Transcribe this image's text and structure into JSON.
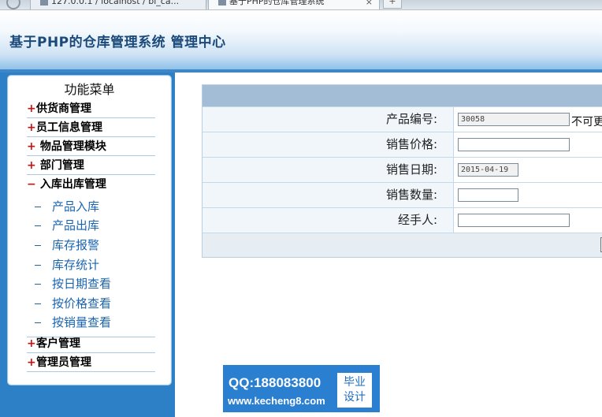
{
  "browser": {
    "tabs": [
      {
        "label": "127.0.0.1 / localhost / bi_ca..."
      },
      {
        "label": "基于PHP的仓库管理系统"
      }
    ],
    "new_tab": "+",
    "close": "×"
  },
  "header": {
    "title": "基于PHP的仓库管理系统 管理中心"
  },
  "sidebar": {
    "title": "功能菜单",
    "items": [
      {
        "sign": "+",
        "label": "供货商管理"
      },
      {
        "sign": "+",
        "label": "员工信息管理"
      },
      {
        "sign": "+",
        "label": " 物品管理模块"
      },
      {
        "sign": "+",
        "label": " 部门管理"
      },
      {
        "sign": "−",
        "label": " 入库出库管理"
      }
    ],
    "sub_items": [
      {
        "label": "产品入库"
      },
      {
        "label": "产品出库"
      },
      {
        "label": "库存报警"
      },
      {
        "label": "库存统计"
      },
      {
        "label": "按日期查看"
      },
      {
        "label": "按价格查看"
      },
      {
        "label": "按销量查看"
      }
    ],
    "bottom_items": [
      {
        "sign": "+",
        "label": "客户管理"
      },
      {
        "sign": "+",
        "label": "管理员管理"
      }
    ]
  },
  "form": {
    "rows": [
      {
        "label": "产品编号:",
        "value": "30058",
        "note": "不可更"
      },
      {
        "label": "销售价格:",
        "value": ""
      },
      {
        "label": "销售日期:",
        "value": "2015-04-19"
      },
      {
        "label": "销售数量:",
        "value": ""
      },
      {
        "label": "经手人:",
        "value": ""
      }
    ]
  },
  "watermark": {
    "qq": "QQ:188083800",
    "url": "www.kecheng8.com",
    "badge_line1": "毕业",
    "badge_line2": "设计"
  }
}
